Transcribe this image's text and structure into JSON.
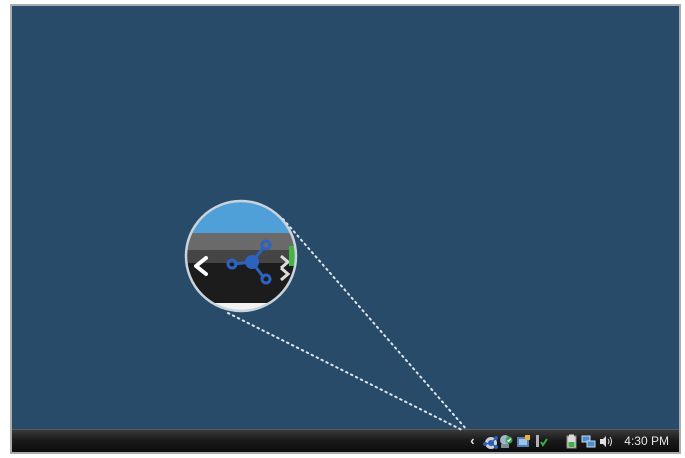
{
  "desktop": {
    "background_color": "#284b69"
  },
  "taskbar": {
    "show_hidden_icons": "‹",
    "icons": [
      {
        "name": "network-share-icon",
        "color": "#2d5fb0"
      },
      {
        "name": "security-shield-icon",
        "color": "#3aa655"
      },
      {
        "name": "device-manager-icon",
        "color": "#5a7fb5"
      },
      {
        "name": "power-status-icon",
        "color": "#3fae3f"
      },
      {
        "name": "battery-icon",
        "color": "#d9d9d9"
      },
      {
        "name": "network-connection-icon",
        "color": "#4b8fd0"
      },
      {
        "name": "volume-icon",
        "color": "#e0e0e0"
      }
    ],
    "clock": "4:30 PM"
  },
  "magnifier": {
    "zoomed_icon": "network-share-icon",
    "chevron": "‹"
  }
}
